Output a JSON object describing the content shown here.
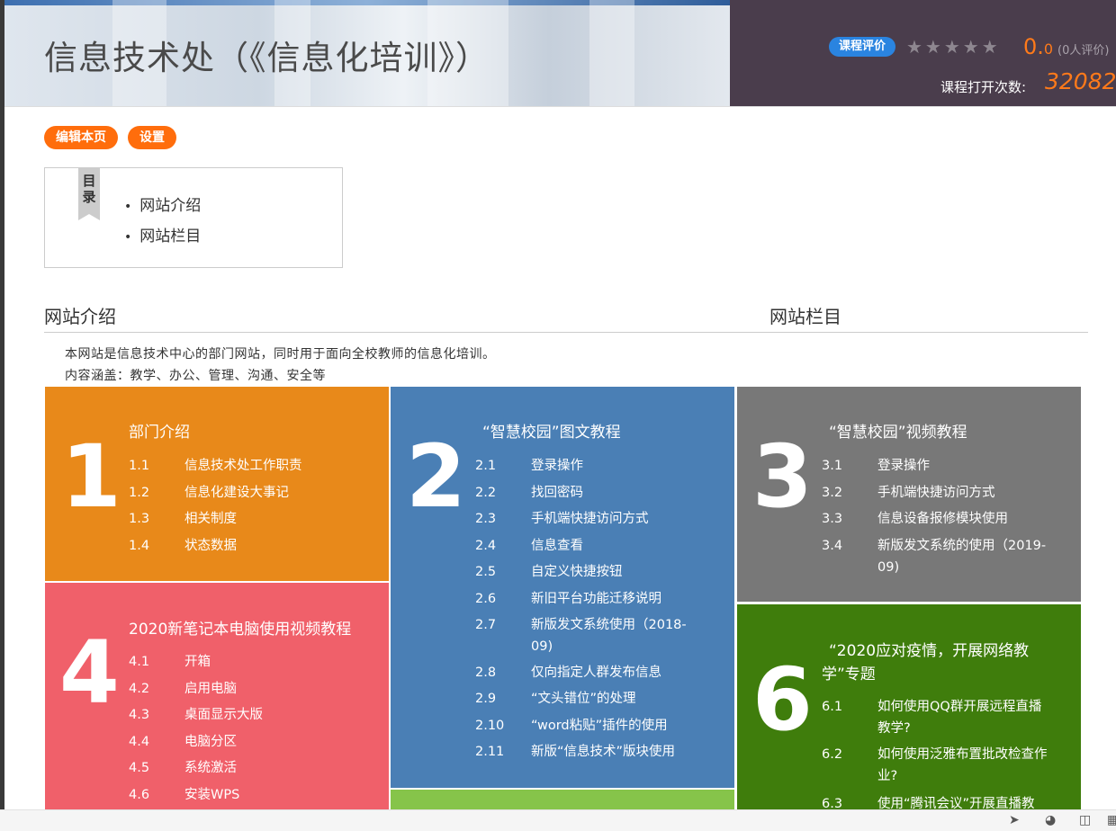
{
  "header": {
    "title": "信息技术处（《信息化培训》）",
    "rating_label": "课程评价",
    "stars": "★★★★★",
    "score_main": "0.",
    "score_small": "0",
    "rating_count": "(0人评价)",
    "open_label": "课程打开次数:",
    "open_count": "32082"
  },
  "toolbar": {
    "edit_label": "编辑本页",
    "settings_label": "设置"
  },
  "toc": {
    "tab_label_1": "目",
    "tab_label_2": "录",
    "items": [
      "网站介绍",
      "网站栏目"
    ]
  },
  "sections": {
    "intro_heading": "网站介绍",
    "columns_heading": "网站栏目",
    "intro_line1": "本网站是信息技术中心的部门网站，同时用于面向全校教师的信息化培训。",
    "intro_line2": "内容涵盖：教学、办公、管理、沟通、安全等"
  },
  "tiles": [
    {
      "number": "1",
      "title": "部门介绍",
      "color": "#e8891a",
      "items": [
        [
          "1.1",
          "信息技术处工作职责"
        ],
        [
          "1.2",
          "信息化建设大事记"
        ],
        [
          "1.3",
          "相关制度"
        ],
        [
          "1.4",
          "状态数据"
        ]
      ]
    },
    {
      "number": "2",
      "title": "“智慧校园”图文教程",
      "color": "#4a7fb5",
      "items": [
        [
          "2.1",
          "登录操作"
        ],
        [
          "2.2",
          "找回密码"
        ],
        [
          "2.3",
          "手机端快捷访问方式"
        ],
        [
          "2.4",
          "信息查看"
        ],
        [
          "2.5",
          "自定义快捷按钮"
        ],
        [
          "2.6",
          "新旧平台功能迁移说明"
        ],
        [
          "2.7",
          "新版发文系统使用（2018-",
          "09)"
        ],
        [
          "2.8",
          "仅向指定人群发布信息"
        ],
        [
          "2.9",
          "“文头错位”的处理"
        ],
        [
          "2.10",
          "“word粘贴”插件的使用"
        ],
        [
          "2.11",
          "新版“信息技术”版块使用"
        ]
      ]
    },
    {
      "number": "3",
      "title": "“智慧校园”视频教程",
      "color": "#787878",
      "items": [
        [
          "3.1",
          "登录操作"
        ],
        [
          "3.2",
          "手机端快捷访问方式"
        ],
        [
          "3.3",
          "信息设备报修模块使用"
        ],
        [
          "3.4",
          "新版发文系统的使用（2019-",
          "09)"
        ]
      ]
    },
    {
      "number": "4",
      "title": "2020新笔记本电脑使用视频教程",
      "color": "#f0606a",
      "items": [
        [
          "4.1",
          "开箱"
        ],
        [
          "4.2",
          "启用电脑"
        ],
        [
          "4.3",
          "桌面显示大版"
        ],
        [
          "4.4",
          "电脑分区"
        ],
        [
          "4.5",
          "系统激活"
        ],
        [
          "4.6",
          "安装WPS"
        ]
      ]
    },
    {
      "number": "6",
      "title_line1": "“2020应对疫情，开展网络教",
      "title_line2": "学”专题",
      "color": "#3f7d0c",
      "items": [
        [
          "6.1",
          "如何使用QQ群开展远程直播",
          "教学?"
        ],
        [
          "6.2",
          "如何使用泛雅布置批改检查作",
          "业?"
        ],
        [
          "6.3",
          "使用“腾讯会议”开展直播教"
        ]
      ]
    },
    {
      "color": "#86c44a"
    }
  ]
}
